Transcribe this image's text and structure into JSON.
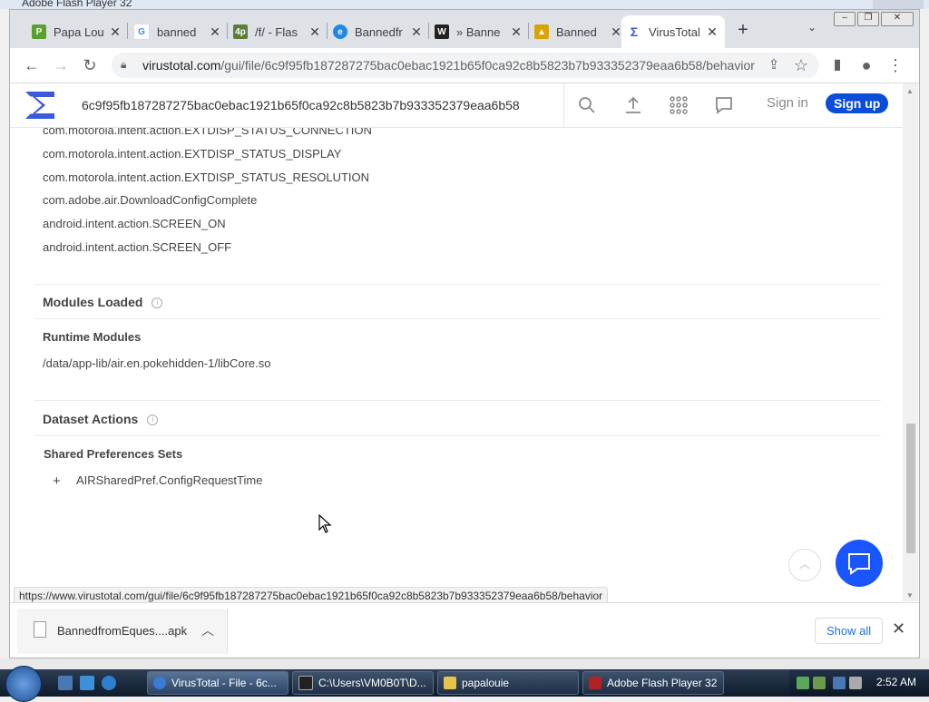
{
  "flash_window": {
    "title": "Adobe Flash Player 32"
  },
  "browser": {
    "tabs": [
      {
        "label": "Papa Lou",
        "favicon": "papa-louie-icon",
        "color": "#5aa02c"
      },
      {
        "label": "banned",
        "favicon": "google-icon",
        "color": "#4285f4"
      },
      {
        "label": "/f/ - Flas",
        "favicon": "4chan-icon",
        "color": "#5b7f3b"
      },
      {
        "label": "Bannedfr",
        "favicon": "edge-icon",
        "color": "#1e88e5"
      },
      {
        "label": "» Banne",
        "favicon": "alien-icon",
        "color": "#222222"
      },
      {
        "label": "Banned",
        "favicon": "thumb-icon",
        "color": "#d8a400"
      },
      {
        "label": "VirusTotal",
        "favicon": "virustotal-icon",
        "color": "#3a5ad9",
        "active": true
      }
    ],
    "new_tab_symbol": "+",
    "url_domain": "virustotal.com",
    "url_path": "/gui/file/6c9f95fb187287275bac0ebac1921b65f0ca92c8b5823b7b933352379eaa6b58/behavior"
  },
  "vt_header": {
    "search_value": "6c9f95fb187287275bac0ebac1921b65f0ca92c8b5823b7b933352379eaa6b58",
    "sign_in": "Sign in",
    "sign_up": "Sign up"
  },
  "intents": [
    "com.motorola.intent.action.EXTDISP_STATUS_CONNECTION",
    "com.motorola.intent.action.EXTDISP_STATUS_DISPLAY",
    "com.motorola.intent.action.EXTDISP_STATUS_RESOLUTION",
    "com.adobe.air.DownloadConfigComplete",
    "android.intent.action.SCREEN_ON",
    "android.intent.action.SCREEN_OFF"
  ],
  "modules_loaded": {
    "title": "Modules Loaded",
    "subtitle": "Runtime Modules",
    "items": [
      "/data/app-lib/air.en.pokehidden-1/libCore.so"
    ]
  },
  "dataset_actions": {
    "title": "Dataset Actions",
    "subtitle": "Shared Preferences Sets",
    "expand_symbol": "+",
    "items": [
      "AIRSharedPref.ConfigRequestTime"
    ]
  },
  "status_url": "https://www.virustotal.com/gui/file/6c9f95fb187287275bac0ebac1921b65f0ca92c8b5823b7b933352379eaa6b58/behavior",
  "download_shelf": {
    "file_name": "BannedfromEques....apk",
    "show_all": "Show all"
  },
  "taskbar": {
    "tasks": [
      {
        "label": "VirusTotal - File - 6c...",
        "color": "#3a7bd5",
        "active": true
      },
      {
        "label": "C:\\Users\\VM0B0T\\D...",
        "color": "#222222",
        "active": false
      },
      {
        "label": "papalouie",
        "color": "#e8c34a",
        "active": false
      },
      {
        "label": "Adobe Flash Player 32",
        "color": "#b22222",
        "active": false
      }
    ],
    "clock": "2:52 AM"
  }
}
